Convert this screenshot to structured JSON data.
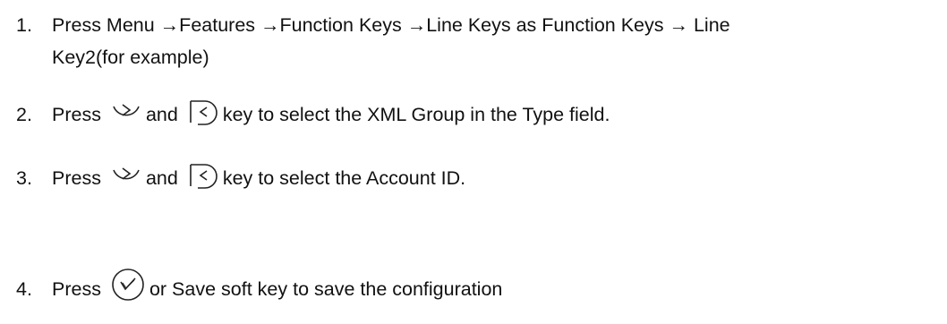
{
  "steps": [
    {
      "number": "1.",
      "line1": "Press Menu →Features →Function Keys →Line Keys as Function Keys →  Line",
      "line2": "Key2(for example)"
    },
    {
      "number": "2.",
      "pre": "Press",
      "mid": "and",
      "post": "key to select the XML Group in the Type field.",
      "icons": [
        "right-navigation-key-icon",
        "left-navigation-key-icon"
      ]
    },
    {
      "number": "3.",
      "pre": "Press",
      "mid": "and",
      "post": "key to select the Account ID.",
      "icons": [
        "right-navigation-key-icon",
        "left-navigation-key-icon"
      ]
    },
    {
      "number": "4.",
      "pre": "Press",
      "post": "or Save soft key to save the  configuration",
      "icons": [
        "ok-key-icon"
      ]
    }
  ]
}
